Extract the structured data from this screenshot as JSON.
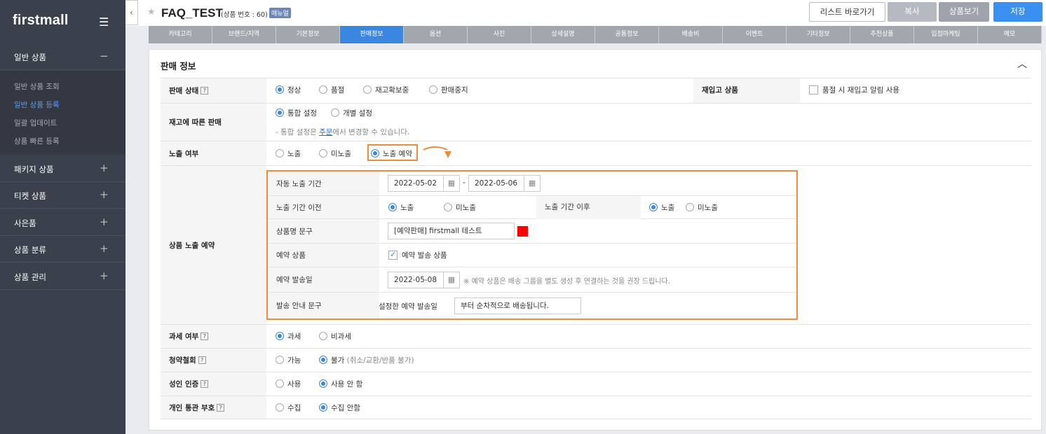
{
  "sidebar": {
    "brand": "firstmall",
    "sections": [
      {
        "label": "일반 상품",
        "sign": "−"
      },
      {
        "label": "패키지 상품",
        "sign": "+"
      },
      {
        "label": "티켓 상품",
        "sign": "+"
      },
      {
        "label": "사은품",
        "sign": "+"
      },
      {
        "label": "상품 분류",
        "sign": "+"
      },
      {
        "label": "상품 관리",
        "sign": "+"
      }
    ],
    "sub_items": [
      "일반 상품 조회",
      "일반 상품 등록",
      "일괄 업데이트",
      "상품 빠른 등록"
    ]
  },
  "header": {
    "title": "FAQ_TEST",
    "product_no": "(상품 번호 : 60)",
    "badge": "매뉴얼",
    "btn_list": "리스트 바로가기",
    "btn_copy": "복사",
    "btn_view": "상품보기",
    "btn_save": "저장"
  },
  "tabs": [
    "카테고리",
    "브랜드/지역",
    "기본정보",
    "판매정보",
    "옵션",
    "사진",
    "상세설명",
    "공통정보",
    "배송비",
    "이벤트",
    "기타정보",
    "추천상품",
    "입점마케팅",
    "메모"
  ],
  "active_tab": "판매정보",
  "panel": {
    "title": "판매 정보",
    "sale_status": {
      "label": "판매 상태",
      "options": [
        "정상",
        "품절",
        "재고확보중",
        "판매중지"
      ],
      "selected": "정상"
    },
    "restock": {
      "label": "재입고 상품",
      "checkbox": "품절 시 재입고 알림 사용"
    },
    "stock_sale": {
      "label": "재고에 따른 판매",
      "options": [
        "통합 설정",
        "개별 설정"
      ],
      "selected": "통합 설정",
      "note_pre": "- 통합 설정은 ",
      "note_link": "주문",
      "note_post": "에서 변경할 수 있습니다."
    },
    "exposure": {
      "label": "노출 여부",
      "options": [
        "노출",
        "미노출",
        "노출 예약"
      ],
      "selected": "노출 예약"
    },
    "reservation": {
      "label": "상품 노출 예약",
      "period_label": "자동 노출 기간",
      "start": "2022-05-02",
      "dash": "-",
      "end": "2022-05-06",
      "before_label": "노출 기간 이전",
      "before_options": [
        "노출",
        "미노출"
      ],
      "after_label": "노출 기간 이후",
      "after_options": [
        "노출",
        "미노출"
      ],
      "name_label": "상품명 문구",
      "name_value": "[예약판매] firstmall 테스트",
      "name_color": "#ff0000",
      "reserve_label": "예약 상품",
      "reserve_checkbox": "예약 발송 상품",
      "ship_date_label": "예약 발송일",
      "ship_date": "2022-05-08",
      "ship_note": "※ 예약 상품은 배송 그룹을 별도 생성 후 연결하는 것을 권장 드립니다.",
      "guide_label": "발송 안내 문구",
      "guide_prefix": "설정한 예약 발송일",
      "guide_value": "부터 순차적으로 배송됩니다."
    },
    "tax": {
      "label": "과세 여부",
      "options": [
        "과세",
        "비과세"
      ],
      "selected": "과세"
    },
    "withdraw": {
      "label": "청약철회",
      "options": [
        "가능",
        "불가"
      ],
      "note": "(취소/교환/반품 불가)",
      "selected": "불가"
    },
    "adult": {
      "label": "성인 인증",
      "options": [
        "사용",
        "사용 안 함"
      ],
      "selected": "사용 안 함"
    },
    "customs": {
      "label": "개인 통관 부호",
      "options": [
        "수집",
        "수집 안함"
      ],
      "selected": "수집 안함"
    }
  }
}
